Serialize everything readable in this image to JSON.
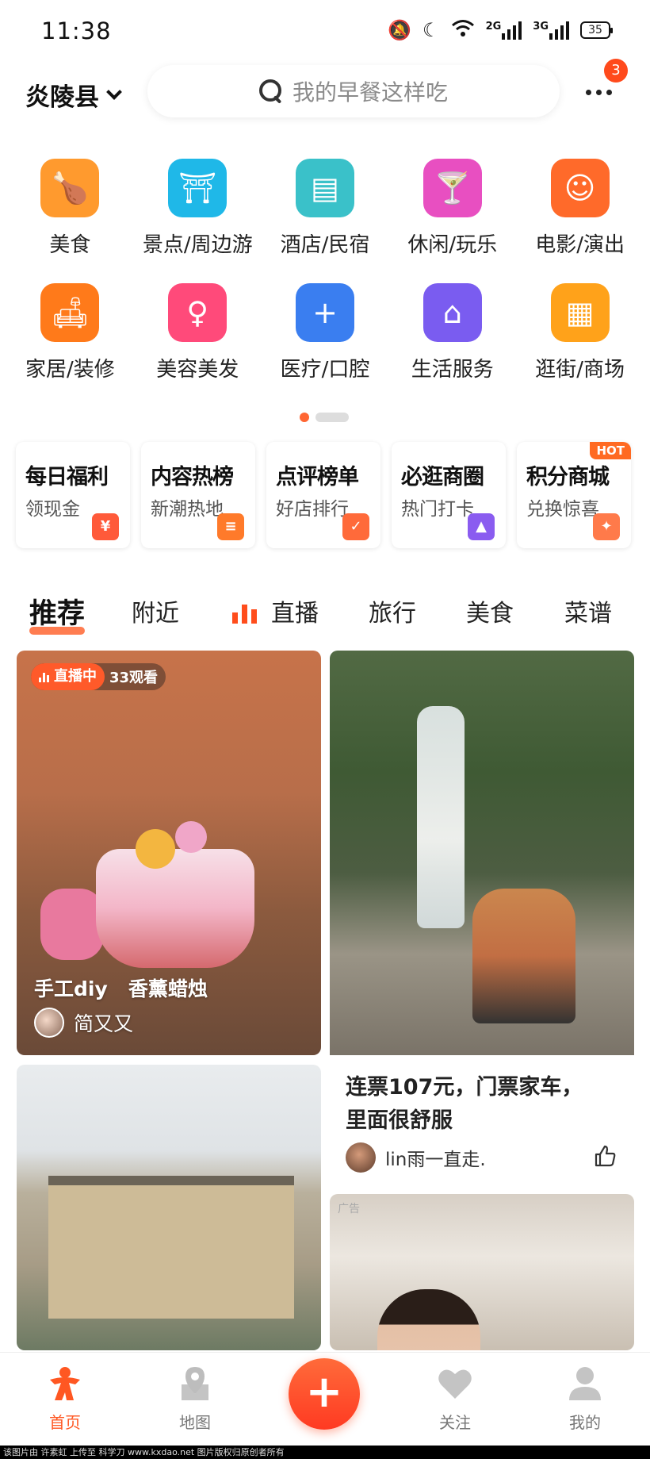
{
  "status_bar": {
    "time": "11:38",
    "network1": "2G",
    "network2": "3G",
    "battery": "35"
  },
  "header": {
    "location": "炎陵县",
    "search_placeholder": "我的早餐这样吃",
    "notification_count": "3"
  },
  "categories": [
    {
      "label": "美食",
      "icon": "roast-chicken-icon",
      "color": "#ff9a2e",
      "glyph": "🍗"
    },
    {
      "label": "景点/周边游",
      "icon": "temple-icon",
      "color": "#1fb8e8",
      "glyph": "⛩"
    },
    {
      "label": "酒店/民宿",
      "icon": "hotel-icon",
      "color": "#3ac1c9",
      "glyph": "▤"
    },
    {
      "label": "休闲/玩乐",
      "icon": "cocktail-icon",
      "color": "#e84fc1",
      "glyph": "🍸"
    },
    {
      "label": "电影/演出",
      "icon": "cat-face-icon",
      "color": "#ff6a2a",
      "glyph": "☺"
    },
    {
      "label": "家居/装修",
      "icon": "sofa-icon",
      "color": "#ff7a1a",
      "glyph": "🛋"
    },
    {
      "label": "美容美发",
      "icon": "woman-profile-icon",
      "color": "#ff4a7a",
      "glyph": "♀"
    },
    {
      "label": "医疗/口腔",
      "icon": "medical-kit-icon",
      "color": "#3a7ef0",
      "glyph": "+"
    },
    {
      "label": "生活服务",
      "icon": "house-pin-icon",
      "color": "#7a5cf0",
      "glyph": "⌂"
    },
    {
      "label": "逛街/商场",
      "icon": "mall-icon",
      "color": "#ffa21a",
      "glyph": "▦"
    }
  ],
  "promos": [
    {
      "title": "每日福利",
      "sub": "领现金",
      "icon": "red-envelope-icon",
      "color": "#ff5a3a",
      "glyph": "¥"
    },
    {
      "title": "内容热榜",
      "sub": "新潮热地",
      "icon": "hot-list-icon",
      "color": "#ff7a2a",
      "glyph": "≡"
    },
    {
      "title": "点评榜单",
      "sub": "好店排行",
      "icon": "ranking-badge-icon",
      "color": "#ff6a3a",
      "glyph": "✓"
    },
    {
      "title": "必逛商圈",
      "sub": "热门打卡",
      "icon": "district-icon",
      "color": "#8a5cf0",
      "glyph": "▲"
    },
    {
      "title": "积分商城",
      "sub": "兑换惊喜",
      "icon": "points-mall-icon",
      "color": "#ff7a4a",
      "glyph": "✦",
      "tag": "HOT"
    }
  ],
  "feed_tabs": [
    "推荐",
    "附近",
    "直播",
    "旅行",
    "美食",
    "菜谱"
  ],
  "feed": {
    "card1": {
      "live_label": "直播中",
      "viewers": "33观看",
      "title": "手工diy   香薰蜡烛",
      "author": "简又又"
    },
    "card2": {
      "title": "连票107元，门票家车，里面很舒服",
      "author": "lin雨一直走."
    },
    "card4": {
      "ad_label": "广告"
    }
  },
  "bottom_nav": [
    "首页",
    "地图",
    "关注",
    "我的"
  ],
  "watermark": "该图片由 许素虹 上传至 科学刀 www.kxdao.net 图片版权归原创者所有",
  "colors": {
    "accent": "#ff5722",
    "badge": "#ff4a1c"
  }
}
